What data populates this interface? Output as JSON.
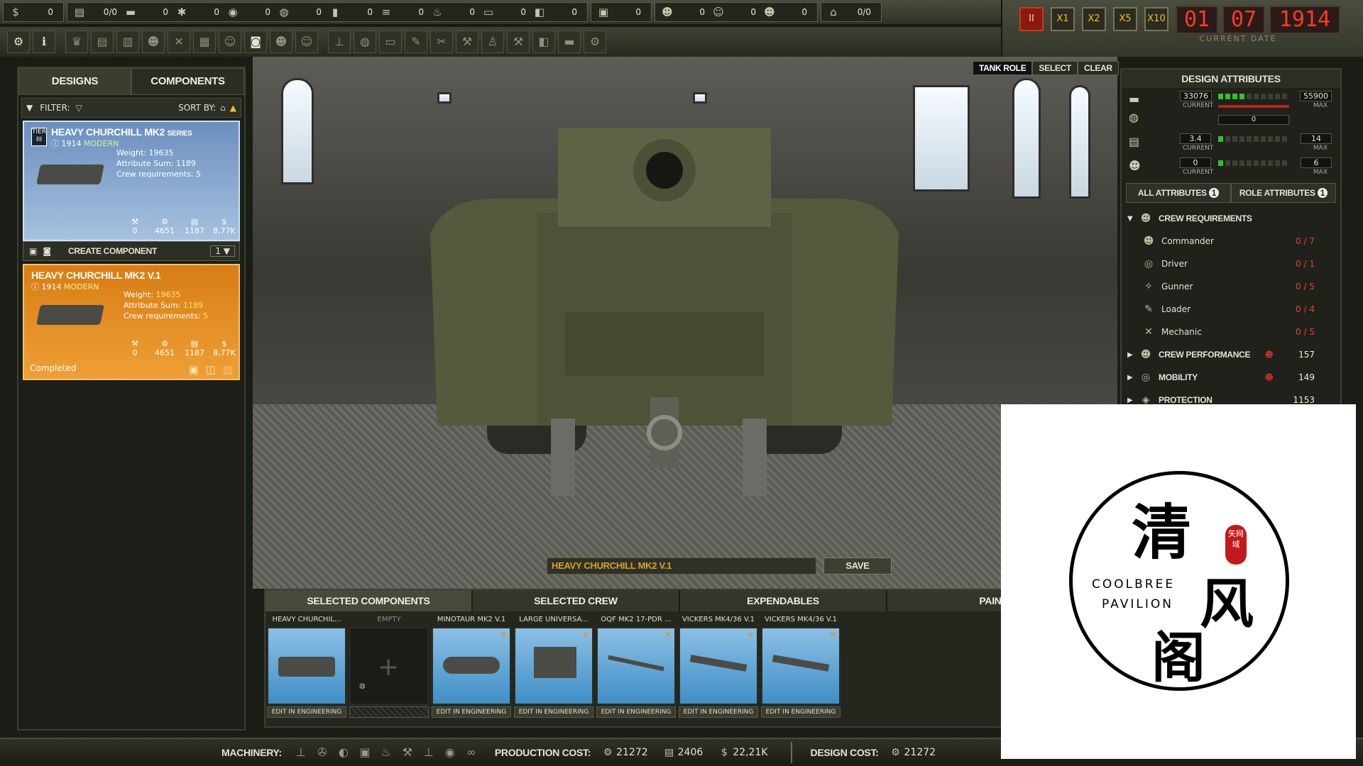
{
  "resources": [
    {
      "icon": "money-bag-icon",
      "glyph": "$",
      "value": "0"
    },
    {
      "icon": "blueprint-icon",
      "glyph": "▤",
      "value": "0/0"
    },
    {
      "icon": "steel-icon",
      "glyph": "▬",
      "value": "0"
    },
    {
      "icon": "gear-parts-icon",
      "glyph": "✱",
      "value": "0"
    },
    {
      "icon": "rubber-icon",
      "glyph": "◉",
      "value": "0"
    },
    {
      "icon": "oil-icon",
      "glyph": "◍",
      "value": "0"
    },
    {
      "icon": "ammo-icon",
      "glyph": "▮",
      "value": "0"
    },
    {
      "icon": "wood-icon",
      "glyph": "≡",
      "value": "0"
    },
    {
      "icon": "fire-icon",
      "glyph": "♨",
      "value": "0"
    },
    {
      "icon": "plank-icon",
      "glyph": "▭",
      "value": "0"
    },
    {
      "icon": "crate-icon",
      "glyph": "◧",
      "value": "0"
    },
    {
      "icon": "truck-icon",
      "glyph": "▣",
      "value": "0"
    },
    {
      "icon": "officer-icon",
      "glyph": "☻",
      "value": "0"
    },
    {
      "icon": "soldier-icon",
      "glyph": "☺",
      "value": "0"
    },
    {
      "icon": "worker-icon",
      "glyph": "☻",
      "value": "0"
    },
    {
      "icon": "housing-icon",
      "glyph": "⌂",
      "value": "0/0"
    }
  ],
  "time": {
    "speeds": [
      "X1",
      "X2",
      "X5",
      "X10"
    ],
    "date_day": "01",
    "date_month": "07",
    "date_year": "1914",
    "date_label": "CURRENT DATE"
  },
  "left": {
    "tab_designs": "DESIGNS",
    "tab_components": "COMPONENTS",
    "filter_label": "FILTER:",
    "sortby_label": "SORT BY:",
    "card1": {
      "name": "HEAVY CHURCHILL MK2",
      "tag": "SERIES",
      "year": "1914",
      "era": "MODERN",
      "tier": "TIER III",
      "weight": "Weight: 19635",
      "attr": "Attribute Sum: 1189",
      "crew": "Crew requirements: 5",
      "stats": [
        "0",
        "4651",
        "1187",
        "8,77K"
      ]
    },
    "create_label": "CREATE COMPONENT",
    "create_qty": "1",
    "card2": {
      "name": "HEAVY CHURCHILL MK2 V.1",
      "year": "1914",
      "era": "MODERN",
      "weight_lbl": "Weight:",
      "weight": "19635",
      "attr_lbl": "Attribute Sum:",
      "attr": "1189",
      "crew_lbl": "Crew requirements:",
      "crew": "5",
      "stats": [
        "0",
        "4651",
        "1187",
        "8,77K"
      ],
      "status": "Completed"
    }
  },
  "viewport": {
    "tankrole": "TANK ROLE",
    "select": "SELECT",
    "clear": "CLEAR",
    "design_name": "HEAVY CHURCHILL MK2 V.1",
    "save": "SAVE"
  },
  "attributes": {
    "title": "DESIGN ATTRIBUTES",
    "weight": {
      "current": "33076",
      "max": "55900",
      "sub": "0",
      "current_label": "CURRENT",
      "max_label": "MAX"
    },
    "row2": {
      "current": "3.4",
      "max": "14",
      "current_label": "CURRENT",
      "max_label": "MAX"
    },
    "row3": {
      "current": "0",
      "max": "6",
      "current_label": "CURRENT",
      "max_label": "MAX"
    },
    "tab_all": "ALL ATTRIBUTES",
    "tab_all_count": "1",
    "tab_role": "ROLE ATTRIBUTES",
    "tab_role_count": "1",
    "crew_requirements": "CREW REQUIREMENTS",
    "crew": [
      {
        "name": "Commander",
        "value": "0 / 7"
      },
      {
        "name": "Driver",
        "value": "0 / 1"
      },
      {
        "name": "Gunner",
        "value": "0 / 5"
      },
      {
        "name": "Loader",
        "value": "0 / 4"
      },
      {
        "name": "Mechanic",
        "value": "0 / 5"
      }
    ],
    "groups": [
      {
        "name": "CREW PERFORMANCE",
        "value": "157"
      },
      {
        "name": "MOBILITY",
        "value": "149"
      },
      {
        "name": "PROTECTION",
        "value": "1153"
      }
    ]
  },
  "bottom": {
    "tabs": [
      "SELECTED COMPONENTS",
      "SELECTED CREW",
      "EXPENDABLES",
      "PAIN"
    ],
    "components": [
      {
        "name": "HEAVY CHURCHIL...",
        "edit": "EDIT IN ENGINEERING"
      },
      {
        "name": "EMPTY",
        "edit": ""
      },
      {
        "name": "MINOTAUR MK2 V.1",
        "edit": "EDIT IN ENGINEERING"
      },
      {
        "name": "LARGE UNIVERSA...",
        "edit": "EDIT IN ENGINEERING"
      },
      {
        "name": "OQF MK2 17-PDR ...",
        "edit": "EDIT IN ENGINEERING"
      },
      {
        "name": "VICKERS MK4/36 V.1",
        "edit": "EDIT IN ENGINEERING"
      },
      {
        "name": "VICKERS MK4/36 V.1",
        "edit": "EDIT IN ENGINEERING"
      }
    ]
  },
  "status": {
    "machinery": "MACHINERY:",
    "production_cost": "PRODUCTION COST:",
    "prod_gears": "21272",
    "prod_steel": "2406",
    "prod_money": "22,21K",
    "design_cost": "DESIGN COST:",
    "design_gears": "21272"
  },
  "watermark": {
    "char1": "清",
    "char2": "风",
    "char3": "阁",
    "seal": "矢网域",
    "en1": "COOLBREE",
    "en2": "PAVILION"
  },
  "colors": {
    "accent_gold": "#f0c020",
    "date_red": "#ff3a26",
    "card_blue": "#6c8fbf",
    "card_orange": "#d77d14",
    "green_dot": "#33c22c"
  }
}
